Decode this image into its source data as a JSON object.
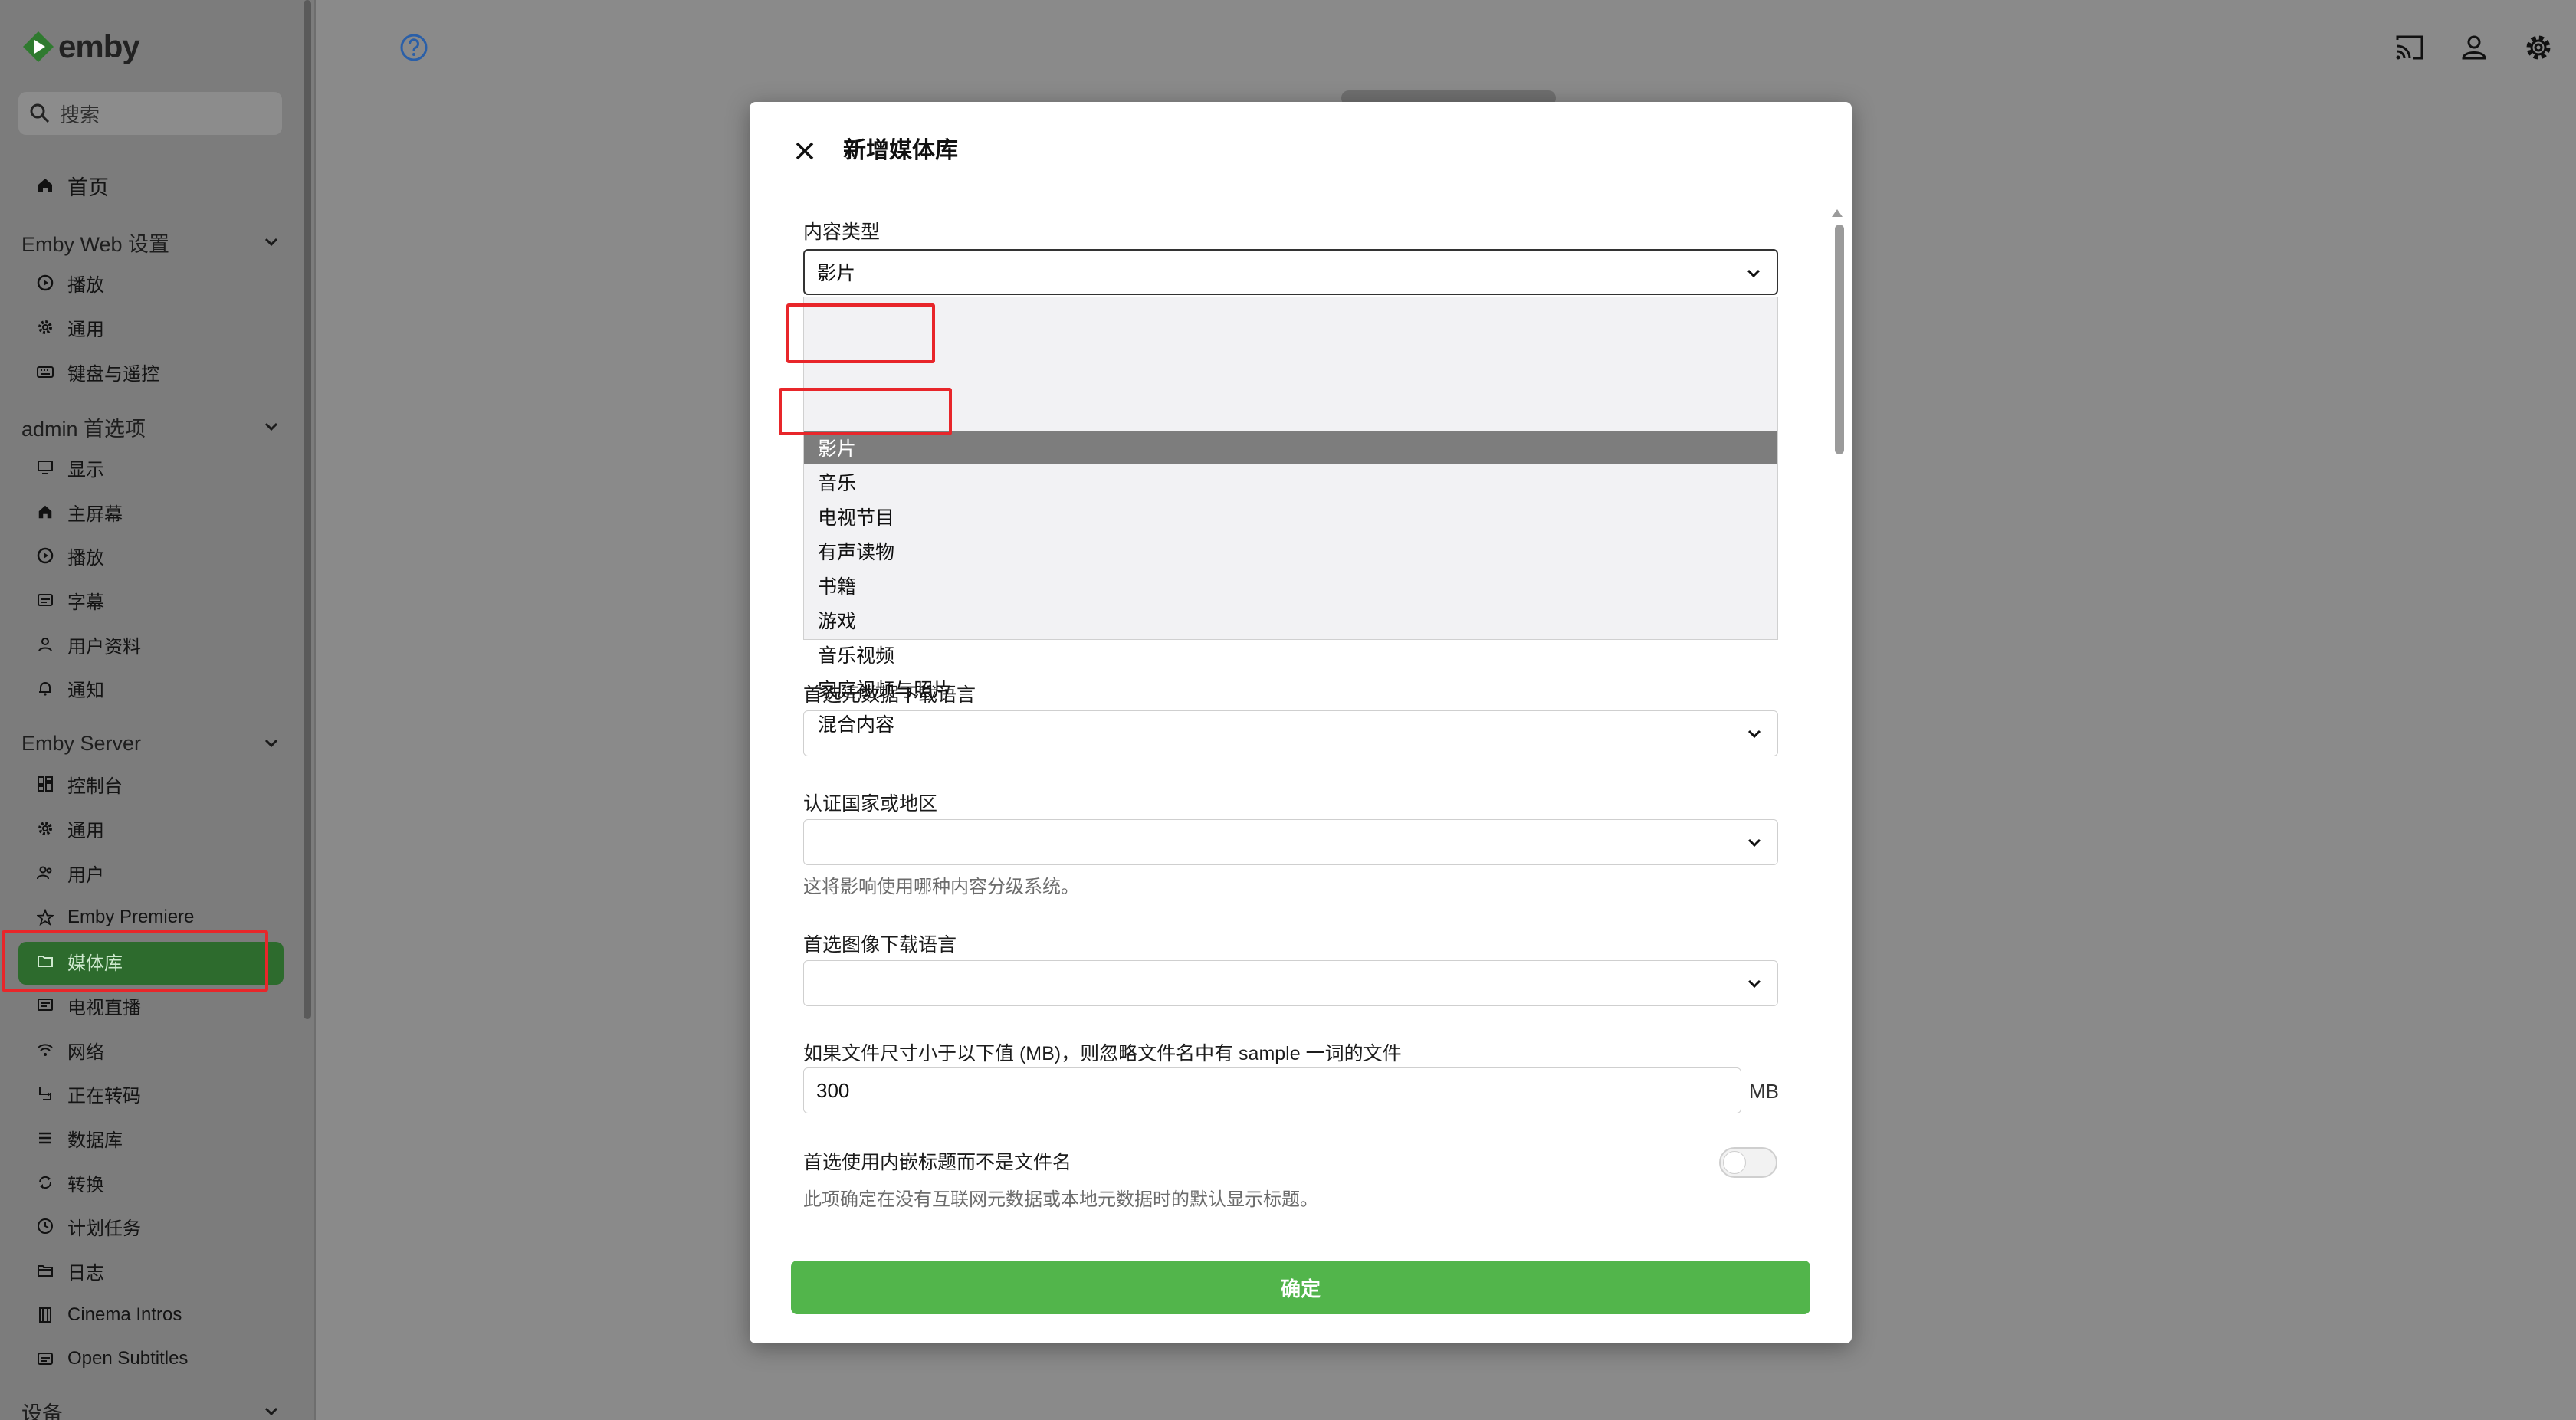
{
  "app": {
    "brand": "emby",
    "accent": "#52b54b"
  },
  "sidebar": {
    "search_placeholder": "搜索",
    "home": "首页",
    "sections": [
      {
        "title": "Emby Web 设置",
        "items": [
          {
            "label": "播放",
            "icon": "play-circle-icon"
          },
          {
            "label": "通用",
            "icon": "gear-icon"
          },
          {
            "label": "键盘与遥控",
            "icon": "keyboard-icon"
          }
        ]
      },
      {
        "title": "admin 首选项",
        "items": [
          {
            "label": "显示",
            "icon": "monitor-icon"
          },
          {
            "label": "主屏幕",
            "icon": "home-icon"
          },
          {
            "label": "播放",
            "icon": "play-circle-icon"
          },
          {
            "label": "字幕",
            "icon": "subtitles-icon"
          },
          {
            "label": "用户资料",
            "icon": "user-icon"
          },
          {
            "label": "通知",
            "icon": "bell-icon"
          }
        ]
      },
      {
        "title": "Emby Server",
        "items": [
          {
            "label": "控制台",
            "icon": "dashboard-icon"
          },
          {
            "label": "通用",
            "icon": "gear-icon"
          },
          {
            "label": "用户",
            "icon": "users-icon"
          },
          {
            "label": "Emby Premiere",
            "icon": "star-icon"
          },
          {
            "label": "媒体库",
            "icon": "folder-icon",
            "active": true
          },
          {
            "label": "电视直播",
            "icon": "tv-guide-icon"
          },
          {
            "label": "网络",
            "icon": "wifi-icon"
          },
          {
            "label": "正在转码",
            "icon": "transcode-icon"
          },
          {
            "label": "数据库",
            "icon": "list-icon"
          },
          {
            "label": "转换",
            "icon": "sync-icon"
          },
          {
            "label": "计划任务",
            "icon": "clock-icon"
          },
          {
            "label": "日志",
            "icon": "folder-open-icon"
          },
          {
            "label": "Cinema Intros",
            "icon": "film-icon"
          },
          {
            "label": "Open Subtitles",
            "icon": "subtitles-icon"
          }
        ]
      },
      {
        "title": "设备",
        "items": []
      }
    ]
  },
  "dialog": {
    "title": "新增媒体库",
    "content_type": {
      "label": "内容类型",
      "value": "影片",
      "options": [
        "影片",
        "音乐",
        "电视节目",
        "有声读物",
        "书籍",
        "游戏",
        "音乐视频",
        "家庭视频与照片",
        "混合内容"
      ],
      "selected_index": 0
    },
    "metadata_language": {
      "label": "首选元数据下载语言",
      "value": ""
    },
    "country": {
      "label": "认证国家或地区",
      "value": "",
      "help": "这将影响使用哪种内容分级系统。"
    },
    "image_language": {
      "label": "首选图像下载语言",
      "value": ""
    },
    "sample_size": {
      "label": "如果文件尺寸小于以下值 (MB)，则忽略文件名中有 sample 一词的文件",
      "value": "300",
      "unit": "MB"
    },
    "embedded_title": {
      "label": "首选使用内嵌标题而不是文件名",
      "help": "此项确定在没有互联网元数据或本地元数据时的默认显示标题。",
      "enabled": false
    },
    "confirm_label": "确定"
  }
}
